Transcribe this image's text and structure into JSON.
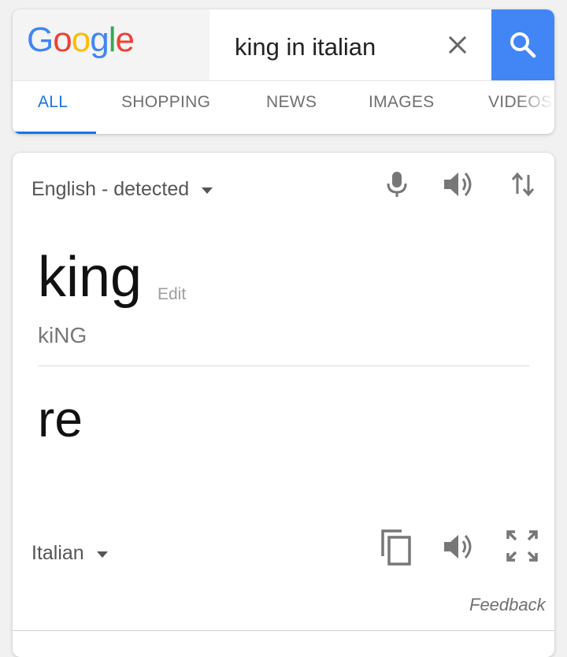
{
  "search": {
    "logo_text": "Google",
    "query": "king in italian"
  },
  "tabs": [
    {
      "label": "ALL",
      "active": true
    },
    {
      "label": "SHOPPING"
    },
    {
      "label": "NEWS"
    },
    {
      "label": "IMAGES"
    },
    {
      "label": "VIDEOS"
    }
  ],
  "translate": {
    "source_language": "English - detected",
    "source_text": "king",
    "edit_label": "Edit",
    "pronunciation": "kiNG",
    "translated_text": "re",
    "target_language": "Italian",
    "feedback_label": "Feedback"
  },
  "colors": {
    "accent": "#1a73e8",
    "search_button": "#4285f4",
    "logo_blue": "#4285f4",
    "logo_red": "#ea4335",
    "logo_yellow": "#fbbc05",
    "logo_green": "#34a853"
  },
  "icons": {
    "clear": "close-icon",
    "search": "search-icon",
    "mic": "microphone-icon",
    "speaker": "speaker-icon",
    "swap": "swap-languages-icon",
    "copy": "copy-icon",
    "expand": "fullscreen-icon"
  }
}
